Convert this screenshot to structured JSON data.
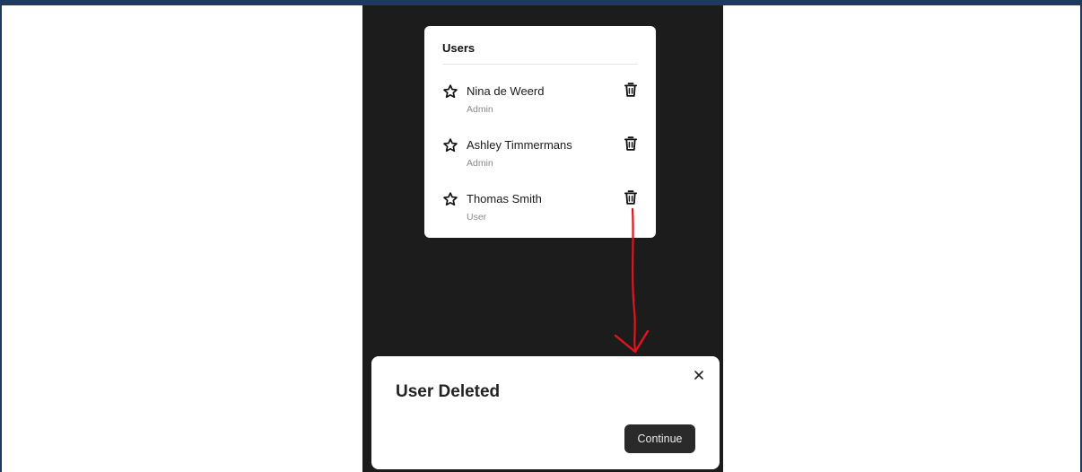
{
  "users_card": {
    "title": "Users",
    "users": [
      {
        "name": "Nina de Weerd",
        "role": "Admin",
        "star_icon": "star-outline-icon",
        "delete_icon": "trash-icon"
      },
      {
        "name": "Ashley Timmermans",
        "role": "Admin",
        "star_icon": "star-outline-icon",
        "delete_icon": "trash-icon"
      },
      {
        "name": "Thomas Smith",
        "role": "User",
        "star_icon": "star-outline-icon",
        "delete_icon": "trash-icon"
      }
    ]
  },
  "toast": {
    "title": "User Deleted",
    "close_icon": "close-icon",
    "button_label": "Continue"
  },
  "colors": {
    "background": "#1c1c1c",
    "card": "#ffffff",
    "button": "#2a2a2a",
    "annotation_arrow": "#e0141e",
    "frame_border": "#1e3a5f"
  }
}
